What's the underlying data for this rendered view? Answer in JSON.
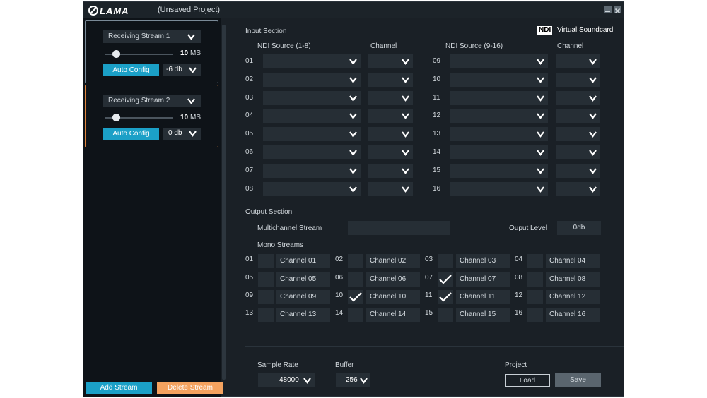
{
  "app": {
    "logo_text": "LAMA",
    "project_title": "(Unsaved Project)",
    "minimize_icon": "minimize-icon",
    "close_icon": "close-icon"
  },
  "sidebar": {
    "streams": [
      {
        "name": "Receiving Stream 1",
        "delay_value": "10",
        "delay_unit": "MS",
        "delay_level": 0.12,
        "auto_label": "Auto Config",
        "gain": "-6 db",
        "selected": false
      },
      {
        "name": "Receiving Stream 2",
        "delay_value": "10",
        "delay_unit": "MS",
        "delay_level": 0.12,
        "auto_label": "Auto Config",
        "gain": "0 db",
        "selected": true
      }
    ],
    "add_label": "Add Stream",
    "delete_label": "Delete Stream"
  },
  "input": {
    "title": "Input Section",
    "ndi_logo": "NDI",
    "ndi_label": "Virtual Soundcard",
    "col_source_a": "NDI Source (1-8)",
    "col_channel_a": "Channel",
    "col_source_b": "NDI Source (9-16)",
    "col_channel_b": "Channel",
    "rows_left": [
      "01",
      "02",
      "03",
      "04",
      "05",
      "06",
      "07",
      "08"
    ],
    "rows_right": [
      "09",
      "10",
      "11",
      "12",
      "13",
      "14",
      "15",
      "16"
    ]
  },
  "output": {
    "title": "Output Section",
    "multichannel_label": "Multichannel  Stream",
    "multichannel_value": "",
    "level_label": "Ouput Level",
    "level_value": "0db",
    "mono_title": "Mono Streams",
    "mono": [
      {
        "num": "01",
        "label": "Channel 01",
        "checked": false
      },
      {
        "num": "02",
        "label": "Channel 02",
        "checked": false
      },
      {
        "num": "03",
        "label": "Channel 03",
        "checked": false
      },
      {
        "num": "04",
        "label": "Channel 04",
        "checked": false
      },
      {
        "num": "05",
        "label": "Channel 05",
        "checked": false
      },
      {
        "num": "06",
        "label": "Channel 06",
        "checked": false
      },
      {
        "num": "07",
        "label": "Channel 07",
        "checked": true
      },
      {
        "num": "08",
        "label": "Channel 08",
        "checked": false
      },
      {
        "num": "09",
        "label": "Channel 09",
        "checked": false
      },
      {
        "num": "10",
        "label": "Channel 10",
        "checked": true
      },
      {
        "num": "11",
        "label": "Channel 11",
        "checked": true
      },
      {
        "num": "12",
        "label": "Channel 12",
        "checked": false
      },
      {
        "num": "13",
        "label": "Channel 13",
        "checked": false
      },
      {
        "num": "14",
        "label": "Channel 14",
        "checked": false
      },
      {
        "num": "15",
        "label": "Channel 15",
        "checked": false
      },
      {
        "num": "16",
        "label": "Channel 16",
        "checked": false
      }
    ]
  },
  "footer": {
    "sample_rate_label": "Sample Rate",
    "sample_rate_value": "48000",
    "buffer_label": "Buffer",
    "buffer_value": "256",
    "project_label": "Project",
    "load_label": "Load",
    "save_label": "Save"
  },
  "colors": {
    "accent": "#1ba0c7",
    "delete": "#f4a25f",
    "selected_border": "#e0833c",
    "background": "#1a2026"
  }
}
